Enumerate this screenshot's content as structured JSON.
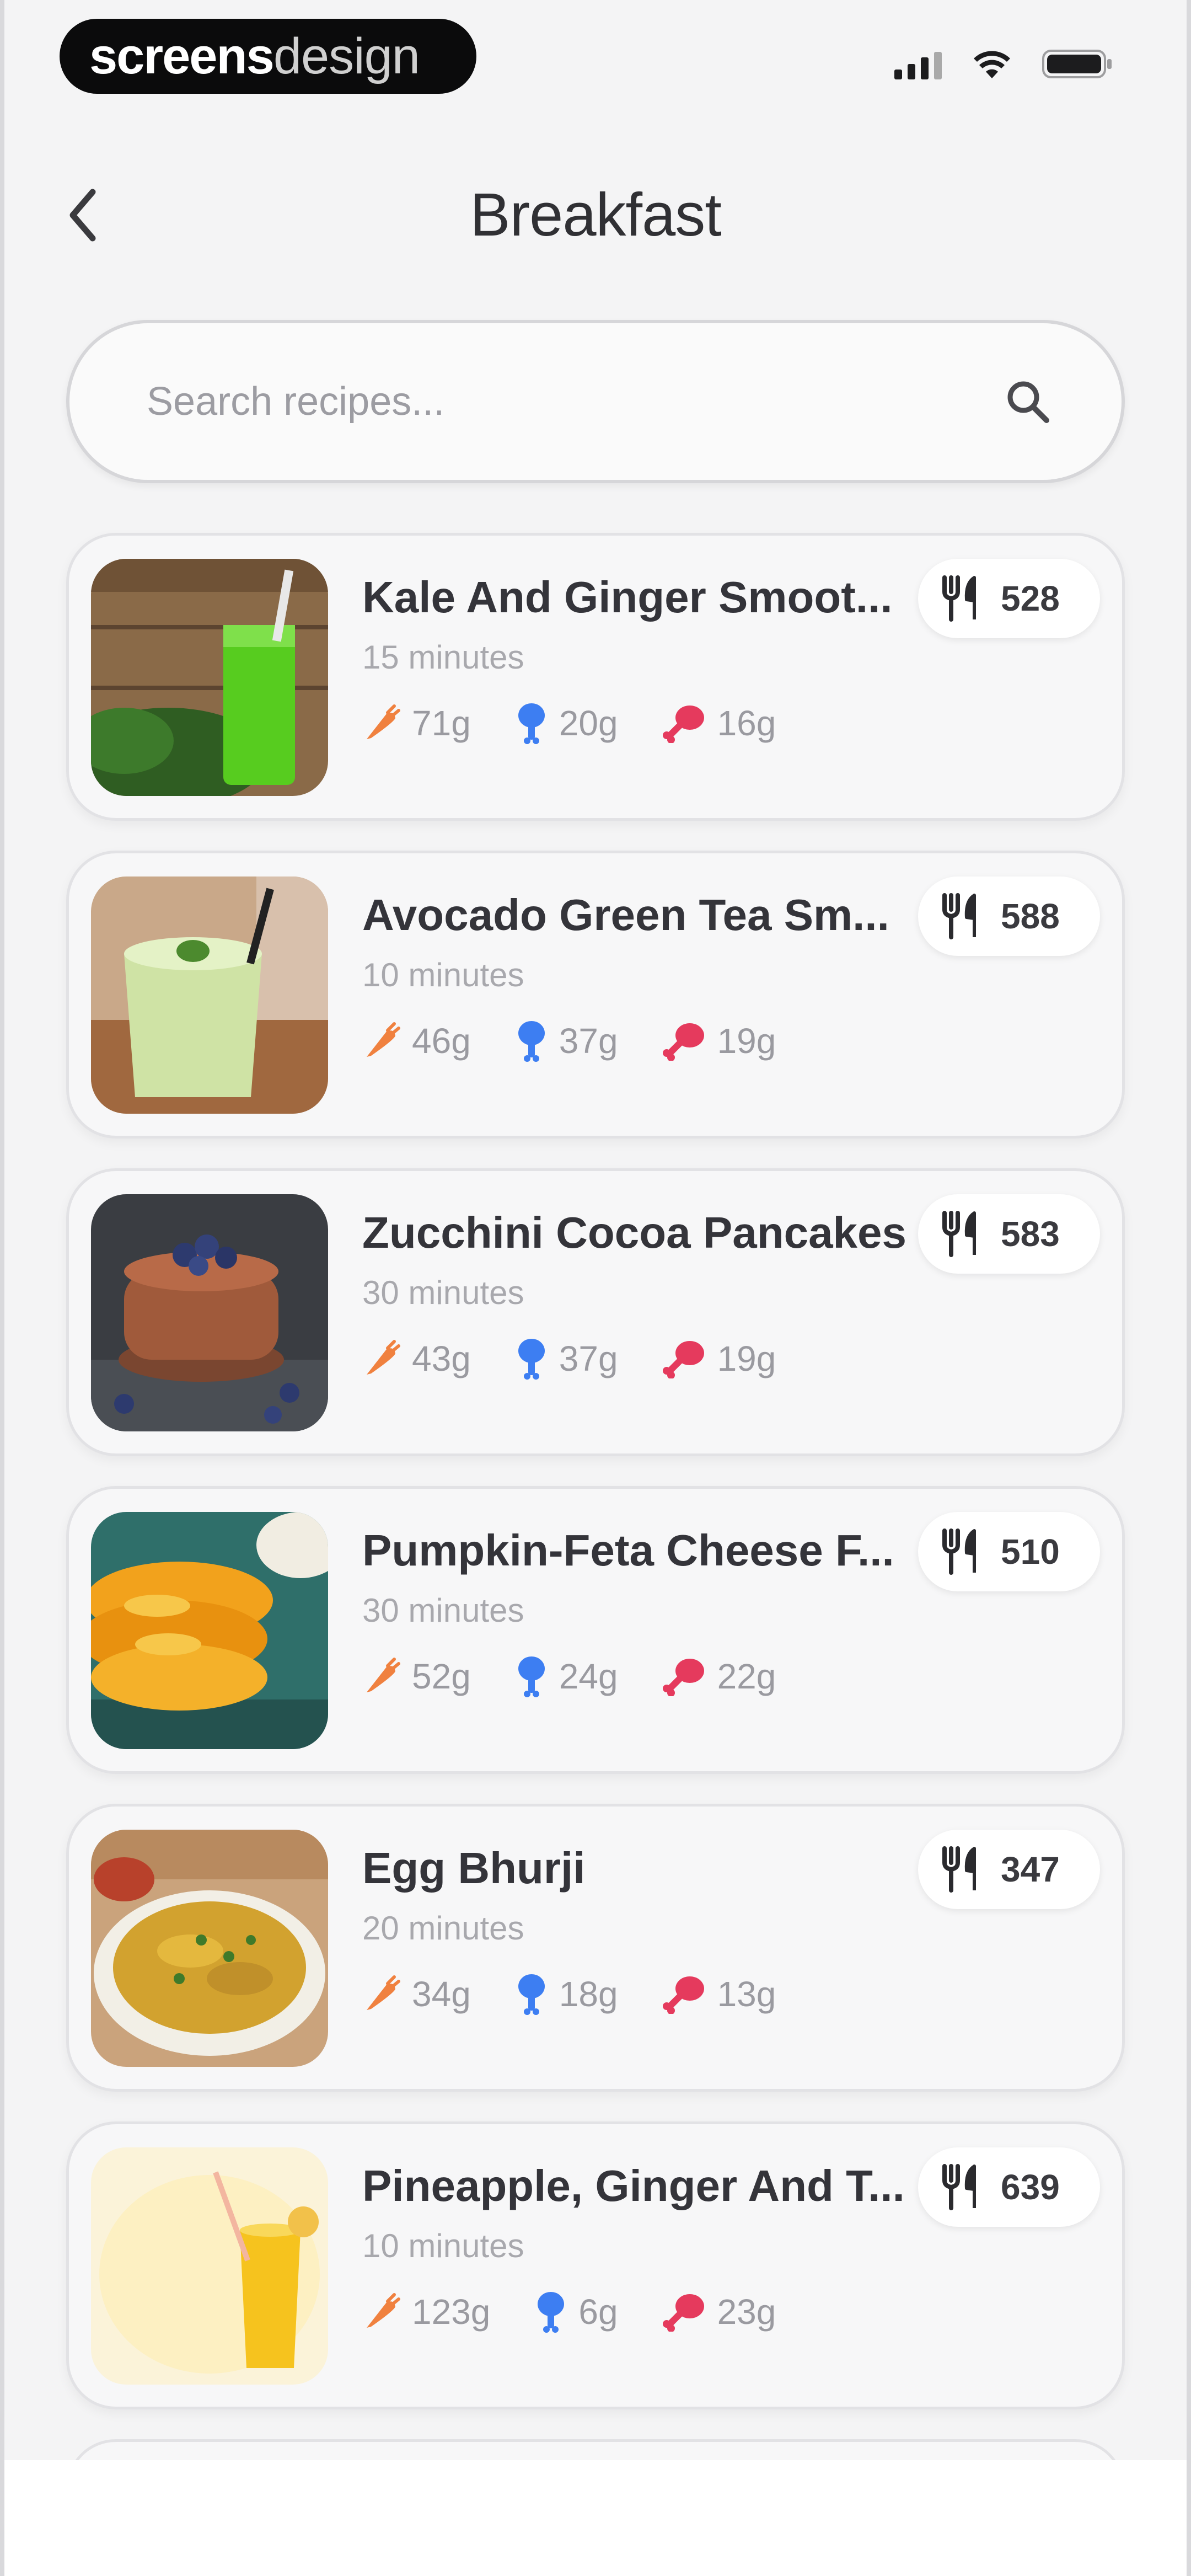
{
  "status_bar": {
    "brand_strong": "screens",
    "brand_light": "design",
    "icons": [
      "signal-icon",
      "wifi-icon",
      "battery-icon"
    ]
  },
  "header": {
    "title": "Breakfast",
    "back_icon": "chevron-left-icon"
  },
  "search": {
    "placeholder": "Search recipes...",
    "value": "",
    "icon": "search-icon"
  },
  "colors": {
    "carbs": "#f0813f",
    "protein": "#3d7ef2",
    "fat": "#e53a5d"
  },
  "recipes": [
    {
      "name": "Kale And Ginger Smoot...",
      "time": "15 minutes",
      "carbs": "71g",
      "protein": "20g",
      "fat": "16g",
      "kcal": "528"
    },
    {
      "name": "Avocado Green Tea Sm...",
      "time": "10 minutes",
      "carbs": "46g",
      "protein": "37g",
      "fat": "19g",
      "kcal": "588"
    },
    {
      "name": "Zucchini Cocoa Pancakes",
      "time": "30 minutes",
      "carbs": "43g",
      "protein": "37g",
      "fat": "19g",
      "kcal": "583"
    },
    {
      "name": "Pumpkin-Feta Cheese F...",
      "time": "30 minutes",
      "carbs": "52g",
      "protein": "24g",
      "fat": "22g",
      "kcal": "510"
    },
    {
      "name": "Egg Bhurji",
      "time": "20 minutes",
      "carbs": "34g",
      "protein": "18g",
      "fat": "13g",
      "kcal": "347"
    },
    {
      "name": "Pineapple, Ginger And T...",
      "time": "10 minutes",
      "carbs": "123g",
      "protein": "6g",
      "fat": "23g",
      "kcal": "639"
    }
  ]
}
